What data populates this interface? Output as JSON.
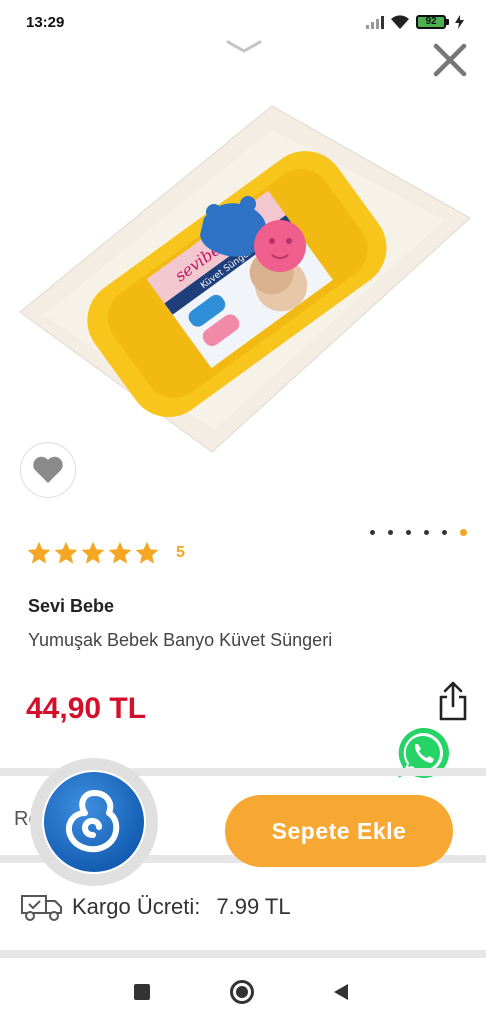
{
  "status_bar": {
    "time": "13:29",
    "battery": "92"
  },
  "product": {
    "brand": "Sevi Bebe",
    "name": "Yumuşak Bebek Banyo Küvet Süngeri",
    "price": "44,90 TL",
    "rating": 5,
    "rating_count": "5",
    "package_brand": "sevibebe",
    "package_label": "Küvet Süngeri"
  },
  "carousel": {
    "count": 6,
    "active_index": 5
  },
  "actions": {
    "partial_label": "Re",
    "add_to_cart_label": "Sepete Ekle"
  },
  "shipping": {
    "label": "Kargo Ücreti:",
    "price": "7.99 TL"
  },
  "colors": {
    "accent": "#f7a833",
    "price": "#d2102c",
    "star": "#f5a623",
    "whatsapp": "#25d366"
  },
  "icons": {
    "chevron": "chevron-down-icon",
    "close": "close-icon",
    "favorite": "heart-icon",
    "share": "share-icon",
    "whatsapp": "whatsapp-icon",
    "truck": "truck-icon",
    "logo": "app-logo-icon"
  }
}
